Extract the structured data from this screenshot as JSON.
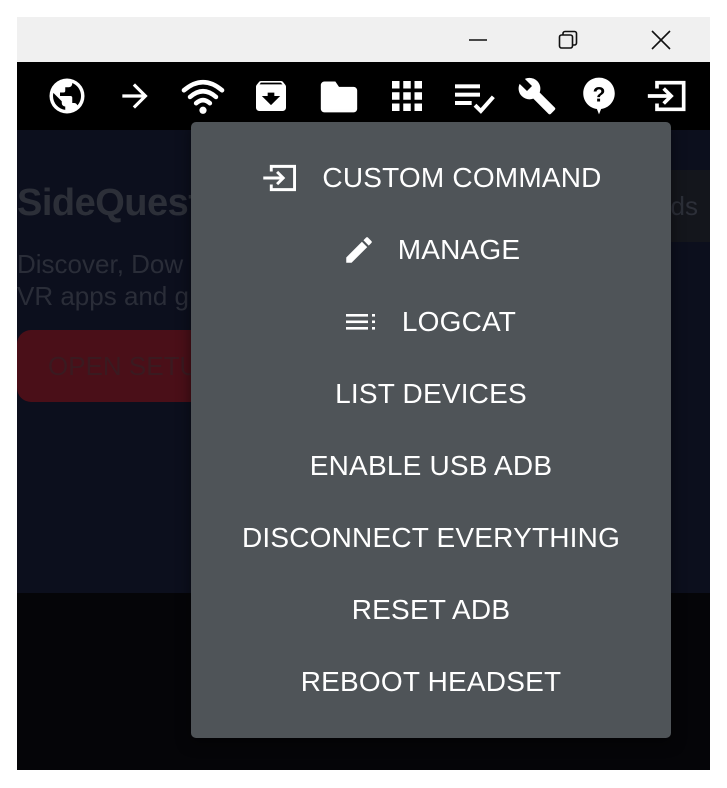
{
  "window": {
    "controls": {
      "minimize_icon": "minimize-icon",
      "restore_icon": "restore-icon",
      "close_icon": "close-icon"
    }
  },
  "toolbar": {
    "icons": [
      "globe-icon",
      "arrow-right-icon",
      "wifi-icon",
      "archive-download-icon",
      "folder-icon",
      "apps-grid-icon",
      "checklist-icon",
      "wrench-icon",
      "help-icon",
      "exit-to-app-icon"
    ]
  },
  "background": {
    "title": "SideQuest",
    "description_line1": "Discover, Dow",
    "description_line2": "VR apps and g",
    "setup_button": "OPEN SETU",
    "downloads_tab": "ds"
  },
  "menu": {
    "items": [
      {
        "label": "CUSTOM COMMAND",
        "icon": "exit-to-app-icon"
      },
      {
        "label": "MANAGE",
        "icon": "pencil-icon"
      },
      {
        "label": "LOGCAT",
        "icon": "list-lines-icon"
      },
      {
        "label": "LIST DEVICES"
      },
      {
        "label": "ENABLE USB ADB"
      },
      {
        "label": "DISCONNECT EVERYTHING"
      },
      {
        "label": "RESET ADB"
      },
      {
        "label": "REBOOT HEADSET"
      }
    ]
  },
  "colors": {
    "menu_bg": "#4f5458",
    "toolbar_bg": "#000000",
    "titlebar_bg": "#f0f0f0",
    "content_bg": "#0c0f1d",
    "accent_button": "#4a0f18"
  }
}
